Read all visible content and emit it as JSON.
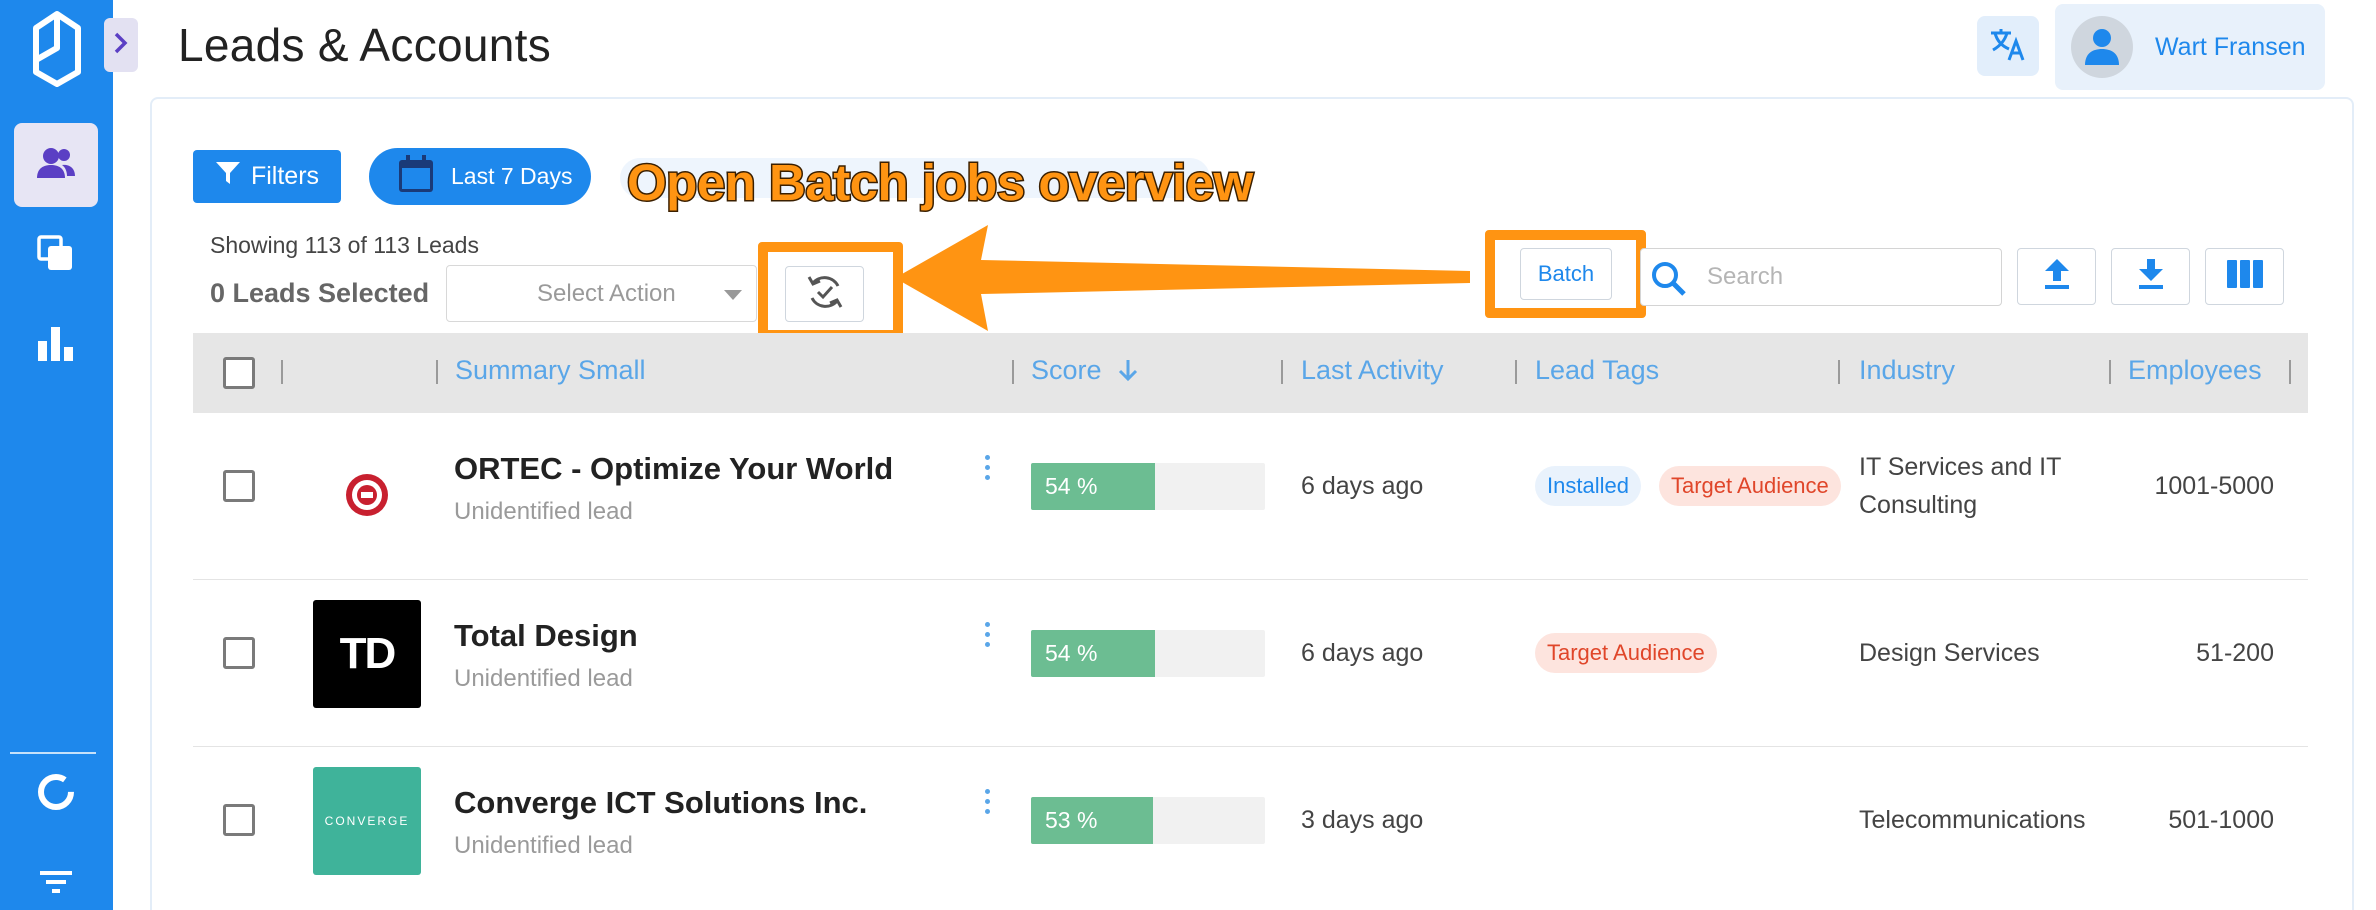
{
  "header": {
    "title": "Leads & Accounts",
    "user_name": "Wart Fransen"
  },
  "toolbar": {
    "filters_label": "Filters",
    "date_label": "Last 7 Days",
    "showing_text": "Showing 113 of 113 Leads",
    "selected_text": "0 Leads Selected",
    "select_action_placeholder": "Select Action",
    "batch_label": "Batch",
    "search_placeholder": "Search"
  },
  "annotation": {
    "text": "Open Batch jobs overview",
    "color": "#ff9412"
  },
  "table": {
    "columns": [
      "Summary Small",
      "Score",
      "Last Activity",
      "Lead Tags",
      "Industry",
      "Employees"
    ],
    "rows": [
      {
        "name": "ORTEC - Optimize Your World",
        "subtitle": "Unidentified lead",
        "score_label": "54 %",
        "score_value": 54,
        "last_activity": "6 days ago",
        "tags": [
          "Installed",
          "Target Audience"
        ],
        "industry_line1": "IT Services and IT",
        "industry_line2": "Consulting",
        "employees": "1001-5000",
        "logo": "ortec-logo"
      },
      {
        "name": "Total Design",
        "subtitle": "Unidentified lead",
        "score_label": "54 %",
        "score_value": 54,
        "last_activity": "6 days ago",
        "tags": [
          "Target Audience"
        ],
        "industry_line1": "Design Services",
        "employees": "51-200",
        "logo": "td-logo",
        "logo_text": "TD"
      },
      {
        "name": "Converge ICT Solutions Inc.",
        "subtitle": "Unidentified lead",
        "score_label": "53 %",
        "score_value": 53,
        "last_activity": "3 days ago",
        "tags": [],
        "industry_line1": "Telecommunications",
        "employees": "501-1000",
        "logo": "converge-logo",
        "logo_text": "CONVERGE"
      }
    ]
  },
  "colors": {
    "primary": "#1e88ec",
    "score_fill": "#6cbd92",
    "tag_blue": "#1e88ec",
    "tag_red": "#e0462a",
    "annotation": "#ff9412"
  },
  "icons": [
    "app-logo-icon",
    "chevron-right-icon",
    "users-icon",
    "copy-icon",
    "bar-chart-icon",
    "donut-icon",
    "filter-lines-icon",
    "translate-icon",
    "user-icon",
    "funnel-icon",
    "calendar-icon",
    "refresh-check-icon",
    "search-icon",
    "upload-icon",
    "download-icon",
    "columns-icon",
    "arrow-down-icon",
    "kebab-icon"
  ]
}
